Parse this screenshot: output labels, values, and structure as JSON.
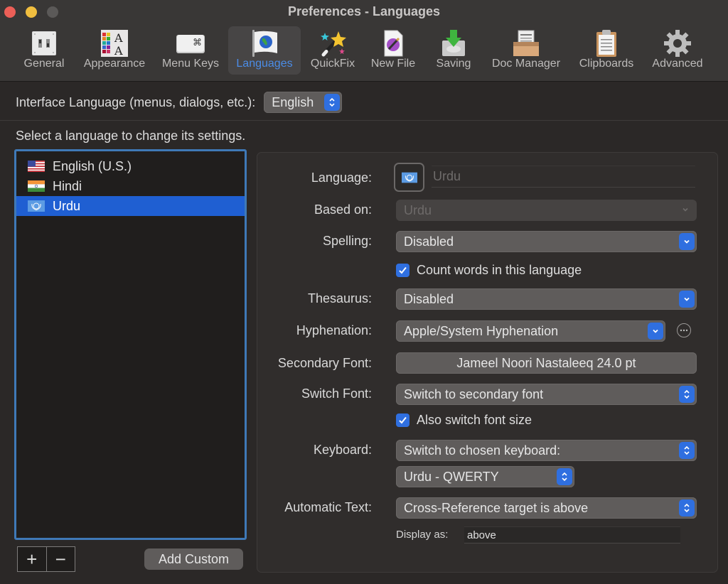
{
  "window": {
    "title": "Preferences - Languages",
    "controls": [
      "close",
      "minimize",
      "zoom"
    ]
  },
  "toolbar": {
    "items": [
      {
        "label": "General",
        "icon": "switches-icon"
      },
      {
        "label": "Appearance",
        "icon": "palette-font-icon"
      },
      {
        "label": "Menu Keys",
        "icon": "command-key-icon"
      },
      {
        "label": "Languages",
        "icon": "globe-flag-icon",
        "active": true
      },
      {
        "label": "QuickFix",
        "icon": "magic-wand-icon"
      },
      {
        "label": "New File",
        "icon": "new-file-icon"
      },
      {
        "label": "Saving",
        "icon": "save-disk-icon"
      },
      {
        "label": "Doc Manager",
        "icon": "inbox-tray-icon"
      },
      {
        "label": "Clipboards",
        "icon": "clipboard-icon"
      },
      {
        "label": "Advanced",
        "icon": "gear-icon"
      }
    ]
  },
  "interface_language": {
    "label": "Interface Language (menus, dialogs, etc.):",
    "value": "English"
  },
  "language_list": {
    "hint": "Select a language to change its settings.",
    "items": [
      {
        "label": "English (U.S.)",
        "flag": "us-flag-icon"
      },
      {
        "label": "Hindi",
        "flag": "india-flag-icon"
      },
      {
        "label": "Urdu",
        "flag": "un-flag-icon",
        "selected": true
      }
    ],
    "add_symbol": "+",
    "remove_symbol": "−",
    "add_custom_label": "Add Custom"
  },
  "settings": {
    "language": {
      "label": "Language:",
      "value": "Urdu"
    },
    "based_on": {
      "label": "Based on:",
      "value": "Urdu"
    },
    "spelling": {
      "label": "Spelling:",
      "value": "Disabled"
    },
    "count_words": {
      "label": "Count words in this language",
      "checked": true
    },
    "thesaurus": {
      "label": "Thesaurus:",
      "value": "Disabled"
    },
    "hyphenation": {
      "label": "Hyphenation:",
      "value": "Apple/System Hyphenation"
    },
    "secondary_font": {
      "label": "Secondary Font:",
      "value": "Jameel Noori Nastaleeq 24.0 pt"
    },
    "switch_font": {
      "label": "Switch Font:",
      "value": "Switch to secondary font"
    },
    "also_switch_size": {
      "label": "Also switch font size",
      "checked": true
    },
    "keyboard": {
      "label": "Keyboard:",
      "value": "Switch to chosen keyboard:",
      "layout": "Urdu - QWERTY"
    },
    "automatic_text": {
      "label": "Automatic Text:",
      "value": "Cross-Reference target is above"
    },
    "display_as": {
      "label": "Display as:",
      "value": "above"
    }
  },
  "colors": {
    "accent": "#2f6fe0",
    "selection": "#1f5fd2",
    "active_tab_text": "#4b8ce6",
    "list_focus_ring": "#3f79b7"
  }
}
